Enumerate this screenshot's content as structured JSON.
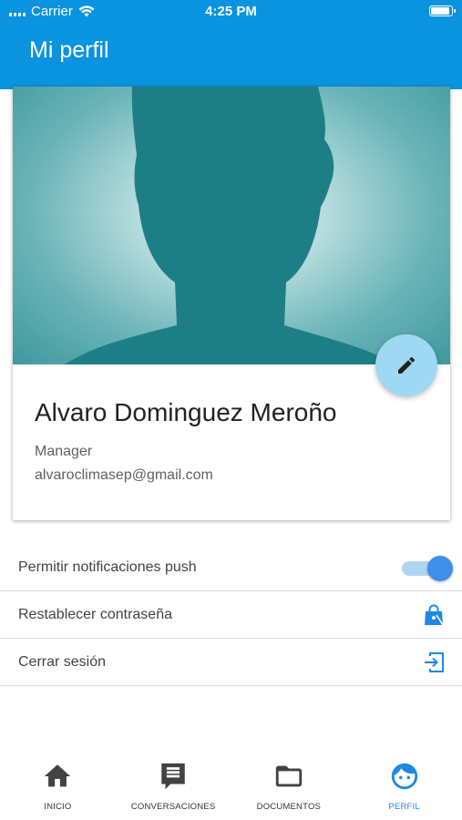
{
  "status_bar": {
    "carrier": "Carrier",
    "time": "4:25 PM"
  },
  "app_bar": {
    "title": "Mi perfil"
  },
  "profile": {
    "name": "Alvaro Dominguez Meroño",
    "role": "Manager",
    "email": "alvaroclimasep@gmail.com"
  },
  "settings": {
    "push": {
      "label": "Permitir notificaciones push",
      "enabled": true
    },
    "reset_password": {
      "label": "Restablecer contraseña"
    },
    "logout": {
      "label": "Cerrar sesión"
    }
  },
  "bottom_nav": {
    "items": [
      {
        "label": "INICIO",
        "icon": "home-icon"
      },
      {
        "label": "CONVERSACIONES",
        "icon": "chat-icon"
      },
      {
        "label": "DOCUMENTOS",
        "icon": "folder-icon"
      },
      {
        "label": "PERFIL",
        "icon": "face-icon",
        "active": true
      }
    ]
  },
  "colors": {
    "primary": "#0a93de",
    "accent": "#1e88e5",
    "fab": "#9fd8f2",
    "avatar_bg": "#6ab4b8",
    "silhouette": "#1d7f86"
  }
}
